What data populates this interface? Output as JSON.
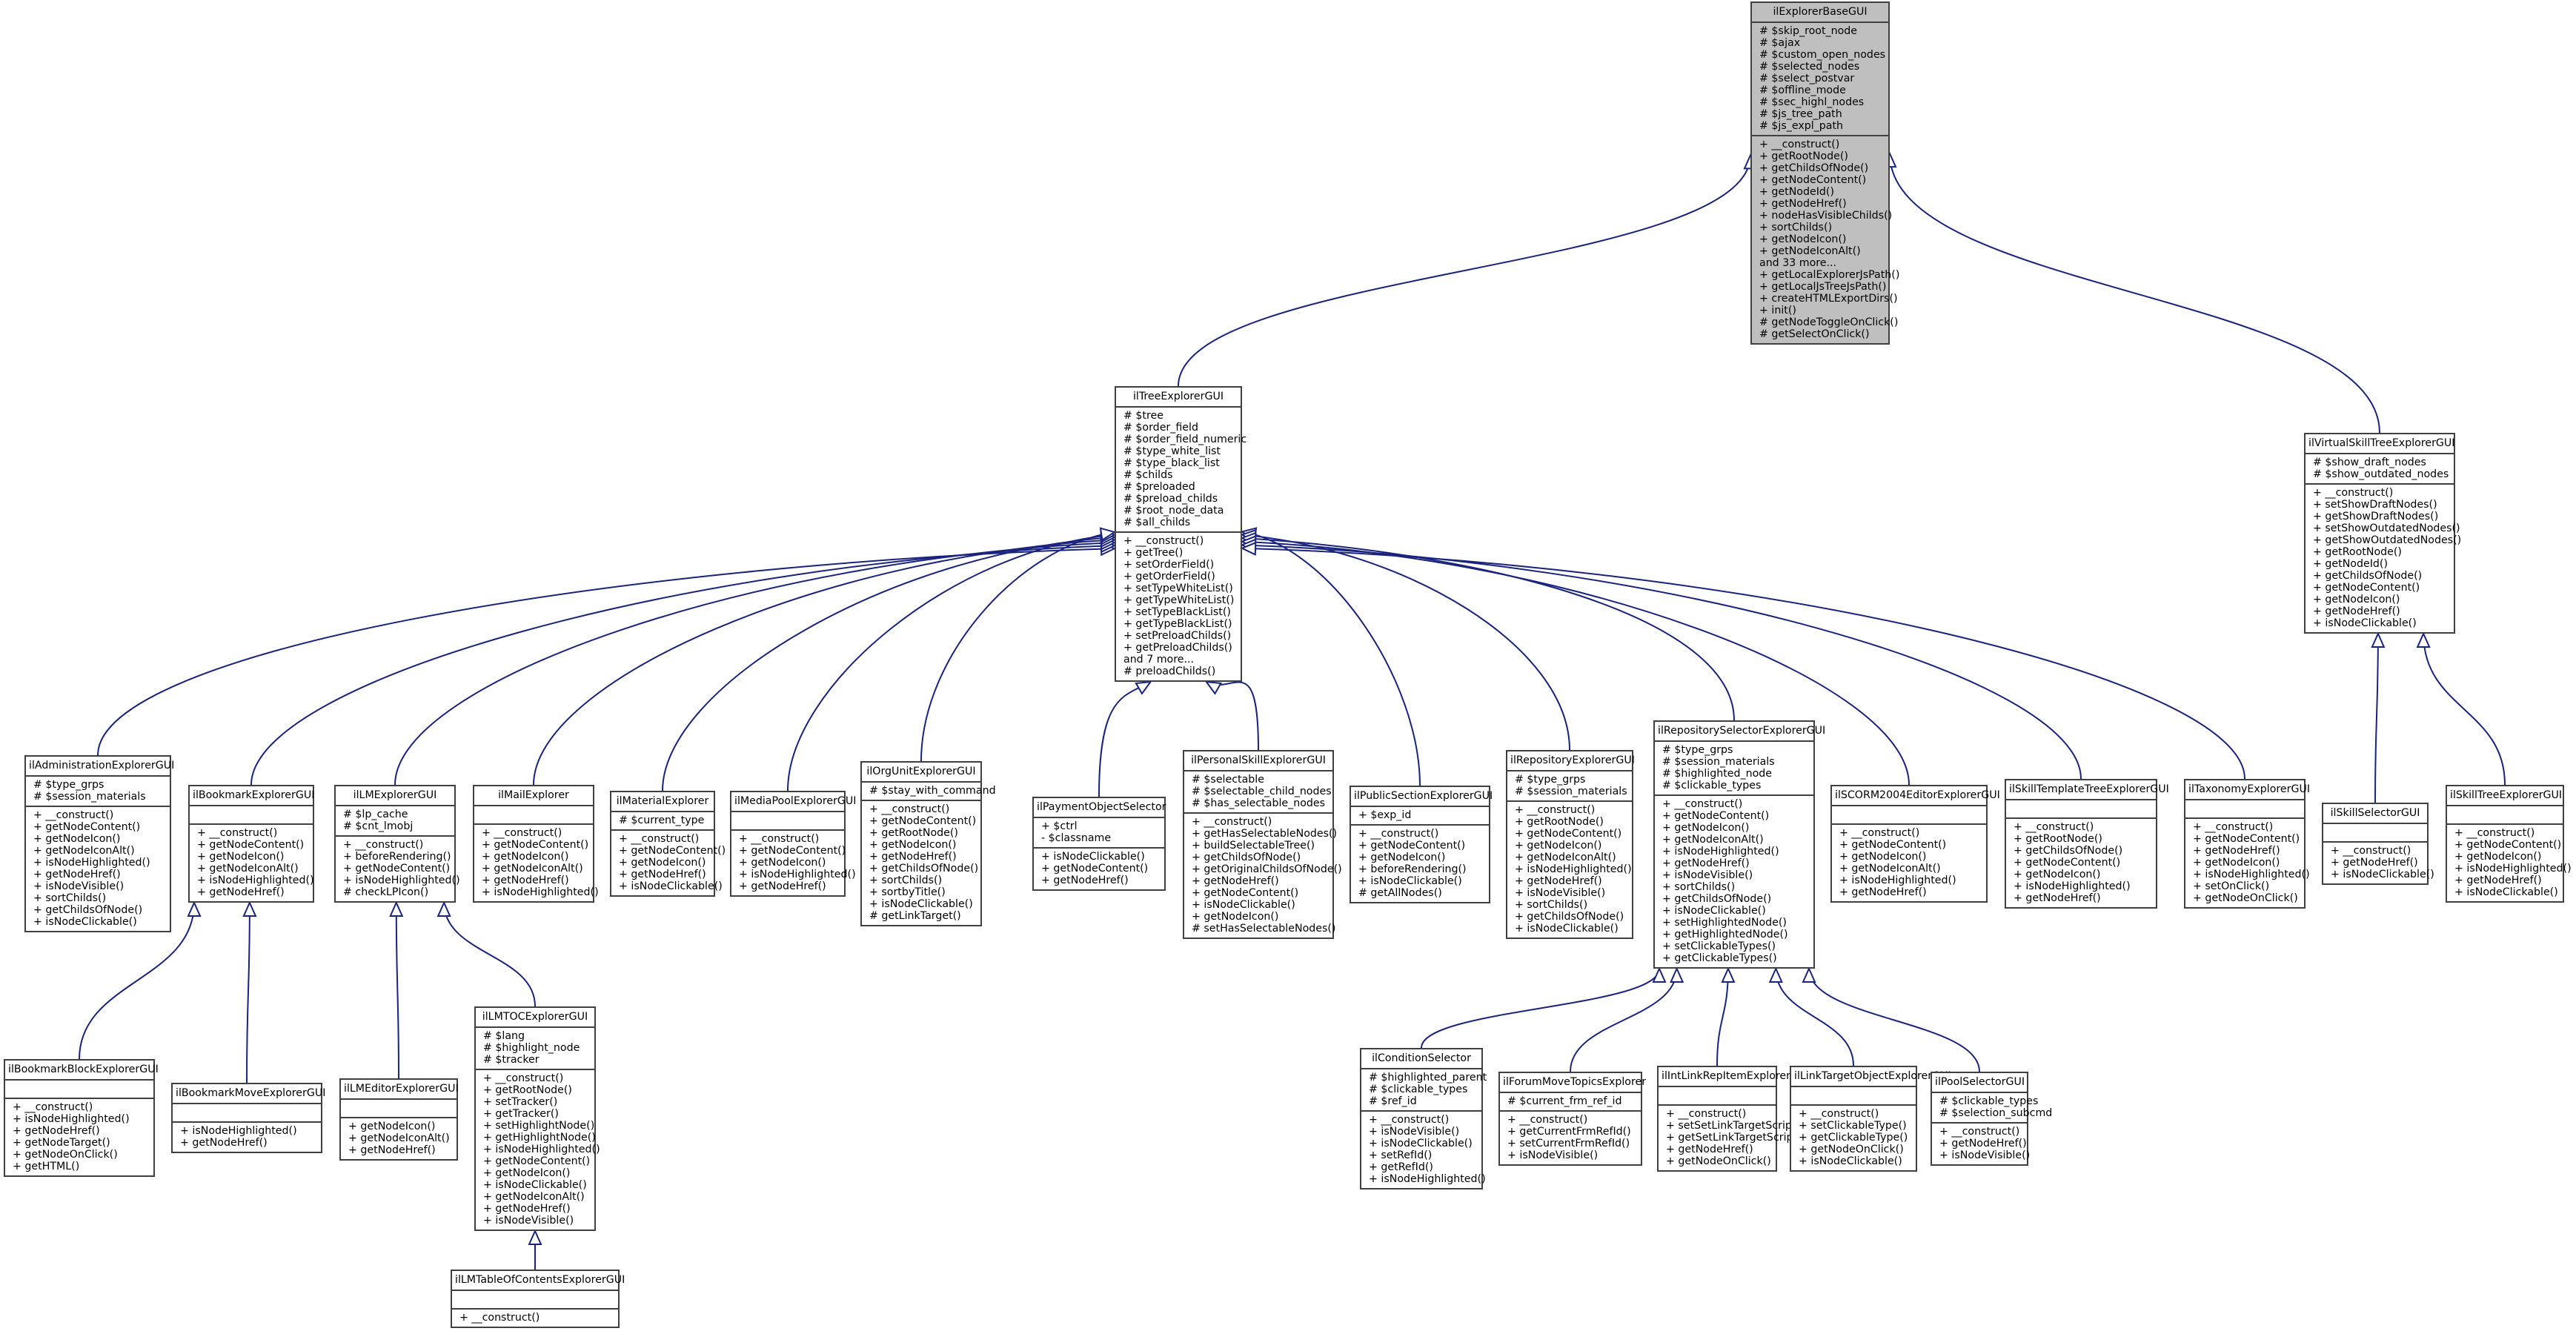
{
  "diagram": {
    "type": "class-inheritance",
    "edge_color": "#1a237e",
    "base_fill": "#bfbfbf",
    "classes": [
      {
        "id": "ilExplorerBaseGUI",
        "name": "ilExplorerBaseGUI",
        "highlight": true,
        "attrs": [
          "# $skip_root_node",
          "# $ajax",
          "# $custom_open_nodes",
          "# $selected_nodes",
          "# $select_postvar",
          "# $offline_mode",
          "# $sec_highl_nodes",
          "# $js_tree_path",
          "# $js_expl_path"
        ],
        "ops": [
          "+ __construct()",
          "+ getRootNode()",
          "+ getChildsOfNode()",
          "+ getNodeContent()",
          "+ getNodeId()",
          "+ getNodeHref()",
          "+ nodeHasVisibleChilds()",
          "+ sortChilds()",
          "+ getNodeIcon()",
          "+ getNodeIconAlt()",
          "and 33 more...",
          "+ getLocalExplorerJsPath()",
          "+ getLocalJsTreeJsPath()",
          "+ createHTMLExportDirs()",
          "+ init()",
          "# getNodeToggleOnClick()",
          "# getSelectOnClick()"
        ]
      },
      {
        "id": "ilTreeExplorerGUI",
        "name": "ilTreeExplorerGUI",
        "parent": "ilExplorerBaseGUI",
        "attrs": [
          "# $tree",
          "# $order_field",
          "# $order_field_numeric",
          "# $type_white_list",
          "# $type_black_list",
          "# $childs",
          "# $preloaded",
          "# $preload_childs",
          "# $root_node_data",
          "# $all_childs"
        ],
        "ops": [
          "+ __construct()",
          "+ getTree()",
          "+ setOrderField()",
          "+ getOrderField()",
          "+ setTypeWhiteList()",
          "+ getTypeWhiteList()",
          "+ setTypeBlackList()",
          "+ getTypeBlackList()",
          "+ setPreloadChilds()",
          "+ getPreloadChilds()",
          "and 7 more...",
          "# preloadChilds()"
        ]
      },
      {
        "id": "ilVirtualSkillTreeExplorerGUI",
        "name": "ilVirtualSkillTreeExplorerGUI",
        "parent": "ilExplorerBaseGUI",
        "attrs": [
          "# $show_draft_nodes",
          "# $show_outdated_nodes"
        ],
        "ops": [
          "+ __construct()",
          "+ setShowDraftNodes()",
          "+ getShowDraftNodes()",
          "+ setShowOutdatedNodes()",
          "+ getShowOutdatedNodes()",
          "+ getRootNode()",
          "+ getNodeId()",
          "+ getChildsOfNode()",
          "+ getNodeContent()",
          "+ getNodeIcon()",
          "+ getNodeHref()",
          "+ isNodeClickable()"
        ]
      },
      {
        "id": "ilAdministrationExplorerGUI",
        "name": "ilAdministrationExplorerGUI",
        "parent": "ilTreeExplorerGUI",
        "attrs": [
          "# $type_grps",
          "# $session_materials"
        ],
        "ops": [
          "+ __construct()",
          "+ getNodeContent()",
          "+ getNodeIcon()",
          "+ getNodeIconAlt()",
          "+ isNodeHighlighted()",
          "+ getNodeHref()",
          "+ isNodeVisible()",
          "+ sortChilds()",
          "+ getChildsOfNode()",
          "+ isNodeClickable()"
        ]
      },
      {
        "id": "ilBookmarkExplorerGUI",
        "name": "ilBookmarkExplorerGUI",
        "parent": "ilTreeExplorerGUI",
        "attrs": [],
        "ops": [
          "+ __construct()",
          "+ getNodeContent()",
          "+ getNodeIcon()",
          "+ getNodeIconAlt()",
          "+ isNodeHighlighted()",
          "+ getNodeHref()"
        ]
      },
      {
        "id": "ilLMExplorerGUI",
        "name": "ilLMExplorerGUI",
        "parent": "ilTreeExplorerGUI",
        "attrs": [
          "# $lp_cache",
          "# $cnt_lmobj"
        ],
        "ops": [
          "+ __construct()",
          "+ beforeRendering()",
          "+ getNodeContent()",
          "+ isNodeHighlighted()",
          "# checkLPIcon()"
        ]
      },
      {
        "id": "ilMailExplorer",
        "name": "ilMailExplorer",
        "parent": "ilTreeExplorerGUI",
        "attrs": [],
        "ops": [
          "+ __construct()",
          "+ getNodeContent()",
          "+ getNodeIcon()",
          "+ getNodeIconAlt()",
          "+ getNodeHref()",
          "+ isNodeHighlighted()"
        ]
      },
      {
        "id": "ilMaterialExplorer",
        "name": "ilMaterialExplorer",
        "parent": "ilTreeExplorerGUI",
        "attrs": [
          "# $current_type"
        ],
        "ops": [
          "+ __construct()",
          "+ getNodeContent()",
          "+ getNodeIcon()",
          "+ getNodeHref()",
          "+ isNodeClickable()"
        ]
      },
      {
        "id": "ilMediaPoolExplorerGUI",
        "name": "ilMediaPoolExplorerGUI",
        "parent": "ilTreeExplorerGUI",
        "attrs": [],
        "ops": [
          "+ __construct()",
          "+ getNodeContent()",
          "+ getNodeIcon()",
          "+ isNodeHighlighted()",
          "+ getNodeHref()"
        ]
      },
      {
        "id": "ilOrgUnitExplorerGUI",
        "name": "ilOrgUnitExplorerGUI",
        "parent": "ilTreeExplorerGUI",
        "attrs": [
          "# $stay_with_command"
        ],
        "ops": [
          "+ __construct()",
          "+ getNodeContent()",
          "+ getRootNode()",
          "+ getNodeIcon()",
          "+ getNodeHref()",
          "+ getChildsOfNode()",
          "+ sortChilds()",
          "+ sortbyTitle()",
          "+ isNodeClickable()",
          "# getLinkTarget()"
        ]
      },
      {
        "id": "ilPaymentObjectSelector",
        "name": "ilPaymentObjectSelector",
        "parent": "ilTreeExplorerGUI",
        "attrs": [
          "+ $ctrl",
          "- $classname"
        ],
        "ops": [
          "+ isNodeClickable()",
          "+ getNodeContent()",
          "+ getNodeHref()"
        ]
      },
      {
        "id": "ilPersonalSkillExplorerGUI",
        "name": "ilPersonalSkillExplorerGUI",
        "parent": "ilTreeExplorerGUI",
        "attrs": [
          "# $selectable",
          "# $selectable_child_nodes",
          "# $has_selectable_nodes"
        ],
        "ops": [
          "+ __construct()",
          "+ getHasSelectableNodes()",
          "+ buildSelectableTree()",
          "+ getChildsOfNode()",
          "+ getOriginalChildsOfNode()",
          "+ getNodeHref()",
          "+ getNodeContent()",
          "+ isNodeClickable()",
          "+ getNodeIcon()",
          "# setHasSelectableNodes()"
        ]
      },
      {
        "id": "ilPublicSectionExplorerGUI",
        "name": "ilPublicSectionExplorerGUI",
        "parent": "ilTreeExplorerGUI",
        "attrs": [
          "+ $exp_id"
        ],
        "ops": [
          "+ __construct()",
          "+ getNodeContent()",
          "+ getNodeIcon()",
          "+ beforeRendering()",
          "+ isNodeClickable()",
          "# getAllNodes()"
        ]
      },
      {
        "id": "ilRepositoryExplorerGUI",
        "name": "ilRepositoryExplorerGUI",
        "parent": "ilTreeExplorerGUI",
        "attrs": [
          "# $type_grps",
          "# $session_materials"
        ],
        "ops": [
          "+ __construct()",
          "+ getRootNode()",
          "+ getNodeContent()",
          "+ getNodeIcon()",
          "+ getNodeIconAlt()",
          "+ isNodeHighlighted()",
          "+ getNodeHref()",
          "+ isNodeVisible()",
          "+ sortChilds()",
          "+ getChildsOfNode()",
          "+ isNodeClickable()"
        ]
      },
      {
        "id": "ilRepositorySelectorExplorerGUI",
        "name": "ilRepositorySelectorExplorerGUI",
        "parent": "ilTreeExplorerGUI",
        "attrs": [
          "# $type_grps",
          "# $session_materials",
          "# $highlighted_node",
          "# $clickable_types"
        ],
        "ops": [
          "+ __construct()",
          "+ getNodeContent()",
          "+ getNodeIcon()",
          "+ getNodeIconAlt()",
          "+ isNodeHighlighted()",
          "+ getNodeHref()",
          "+ isNodeVisible()",
          "+ sortChilds()",
          "+ getChildsOfNode()",
          "+ isNodeClickable()",
          "+ setHighlightedNode()",
          "+ getHighlightedNode()",
          "+ setClickableTypes()",
          "+ getClickableTypes()"
        ]
      },
      {
        "id": "ilSCORM2004EditorExplorerGUI",
        "name": "ilSCORM2004EditorExplorerGUI",
        "parent": "ilTreeExplorerGUI",
        "attrs": [],
        "ops": [
          "+ __construct()",
          "+ getNodeContent()",
          "+ getNodeIcon()",
          "+ getNodeIconAlt()",
          "+ isNodeHighlighted()",
          "+ getNodeHref()"
        ]
      },
      {
        "id": "ilSkillTemplateTreeExplorerGUI",
        "name": "ilSkillTemplateTreeExplorerGUI",
        "parent": "ilTreeExplorerGUI",
        "attrs": [],
        "ops": [
          "+ __construct()",
          "+ getRootNode()",
          "+ getChildsOfNode()",
          "+ getNodeContent()",
          "+ getNodeIcon()",
          "+ isNodeHighlighted()",
          "+ getNodeHref()"
        ]
      },
      {
        "id": "ilTaxonomyExplorerGUI",
        "name": "ilTaxonomyExplorerGUI",
        "parent": "ilTreeExplorerGUI",
        "attrs": [],
        "ops": [
          "+ __construct()",
          "+ getNodeContent()",
          "+ getNodeHref()",
          "+ getNodeIcon()",
          "+ isNodeHighlighted()",
          "+ setOnClick()",
          "+ getNodeOnClick()"
        ]
      },
      {
        "id": "ilSkillSelectorGUI",
        "name": "ilSkillSelectorGUI",
        "parent": "ilVirtualSkillTreeExplorerGUI",
        "attrs": [],
        "ops": [
          "+ __construct()",
          "+ getNodeHref()",
          "+ isNodeClickable()"
        ]
      },
      {
        "id": "ilSkillTreeExplorerGUI",
        "name": "ilSkillTreeExplorerGUI",
        "parent": "ilVirtualSkillTreeExplorerGUI",
        "attrs": [],
        "ops": [
          "+ __construct()",
          "+ getNodeContent()",
          "+ getNodeIcon()",
          "+ isNodeHighlighted()",
          "+ getNodeHref()",
          "+ isNodeClickable()"
        ]
      },
      {
        "id": "ilBookmarkBlockExplorerGUI",
        "name": "ilBookmarkBlockExplorerGUI",
        "parent": "ilBookmarkExplorerGUI",
        "attrs": [],
        "ops": [
          "+ __construct()",
          "+ isNodeHighlighted()",
          "+ getNodeHref()",
          "+ getNodeTarget()",
          "+ getNodeOnClick()",
          "+ getHTML()"
        ]
      },
      {
        "id": "ilBookmarkMoveExplorerGUI",
        "name": "ilBookmarkMoveExplorerGUI",
        "parent": "ilBookmarkExplorerGUI",
        "attrs": [],
        "ops": [
          "+ isNodeHighlighted()",
          "+ getNodeHref()"
        ]
      },
      {
        "id": "ilLMEditorExplorerGUI",
        "name": "ilLMEditorExplorerGUI",
        "parent": "ilLMExplorerGUI",
        "attrs": [],
        "ops": [
          "+ getNodeIcon()",
          "+ getNodeIconAlt()",
          "+ getNodeHref()"
        ]
      },
      {
        "id": "ilLMTOCExplorerGUI",
        "name": "ilLMTOCExplorerGUI",
        "parent": "ilLMExplorerGUI",
        "attrs": [
          "# $lang",
          "# $highlight_node",
          "# $tracker"
        ],
        "ops": [
          "+ __construct()",
          "+ getRootNode()",
          "+ setTracker()",
          "+ getTracker()",
          "+ setHighlightNode()",
          "+ getHighlightNode()",
          "+ isNodeHighlighted()",
          "+ getNodeContent()",
          "+ getNodeIcon()",
          "+ isNodeClickable()",
          "+ getNodeIconAlt()",
          "+ getNodeHref()",
          "+ isNodeVisible()"
        ]
      },
      {
        "id": "ilLMTableOfContentsExplorerGUI",
        "name": "ilLMTableOfContentsExplorerGUI",
        "parent": "ilLMTOCExplorerGUI",
        "attrs": [],
        "ops": [
          "+ __construct()"
        ]
      },
      {
        "id": "ilConditionSelector",
        "name": "ilConditionSelector",
        "parent": "ilRepositorySelectorExplorerGUI",
        "attrs": [
          "# $highlighted_parent",
          "# $clickable_types",
          "# $ref_id"
        ],
        "ops": [
          "+ __construct()",
          "+ isNodeVisible()",
          "+ isNodeClickable()",
          "+ setRefId()",
          "+ getRefId()",
          "+ isNodeHighlighted()"
        ]
      },
      {
        "id": "ilForumMoveTopicsExplorer",
        "name": "ilForumMoveTopicsExplorer",
        "parent": "ilRepositorySelectorExplorerGUI",
        "attrs": [
          "# $current_frm_ref_id"
        ],
        "ops": [
          "+ __construct()",
          "+ getCurrentFrmRefId()",
          "+ setCurrentFrmRefId()",
          "+ isNodeVisible()"
        ]
      },
      {
        "id": "ilIntLinkRepItemExplorerGUI",
        "name": "ilIntLinkRepItemExplorerGUI",
        "parent": "ilRepositorySelectorExplorerGUI",
        "attrs": [],
        "ops": [
          "+ __construct()",
          "+ setSetLinkTargetScript()",
          "+ getSetLinkTargetScript()",
          "+ getNodeHref()",
          "+ getNodeOnClick()"
        ]
      },
      {
        "id": "ilLinkTargetObjectExplorerGUI",
        "name": "ilLinkTargetObjectExplorerGUI",
        "parent": "ilRepositorySelectorExplorerGUI",
        "attrs": [],
        "ops": [
          "+ __construct()",
          "+ setClickableType()",
          "+ getClickableType()",
          "+ getNodeOnClick()",
          "+ isNodeClickable()"
        ]
      },
      {
        "id": "ilPoolSelectorGUI",
        "name": "ilPoolSelectorGUI",
        "parent": "ilRepositorySelectorExplorerGUI",
        "attrs": [
          "# $clickable_types",
          "# $selection_subcmd"
        ],
        "ops": [
          "+ __construct()",
          "+ getNodeHref()",
          "+ isNodeVisible()"
        ]
      }
    ]
  }
}
